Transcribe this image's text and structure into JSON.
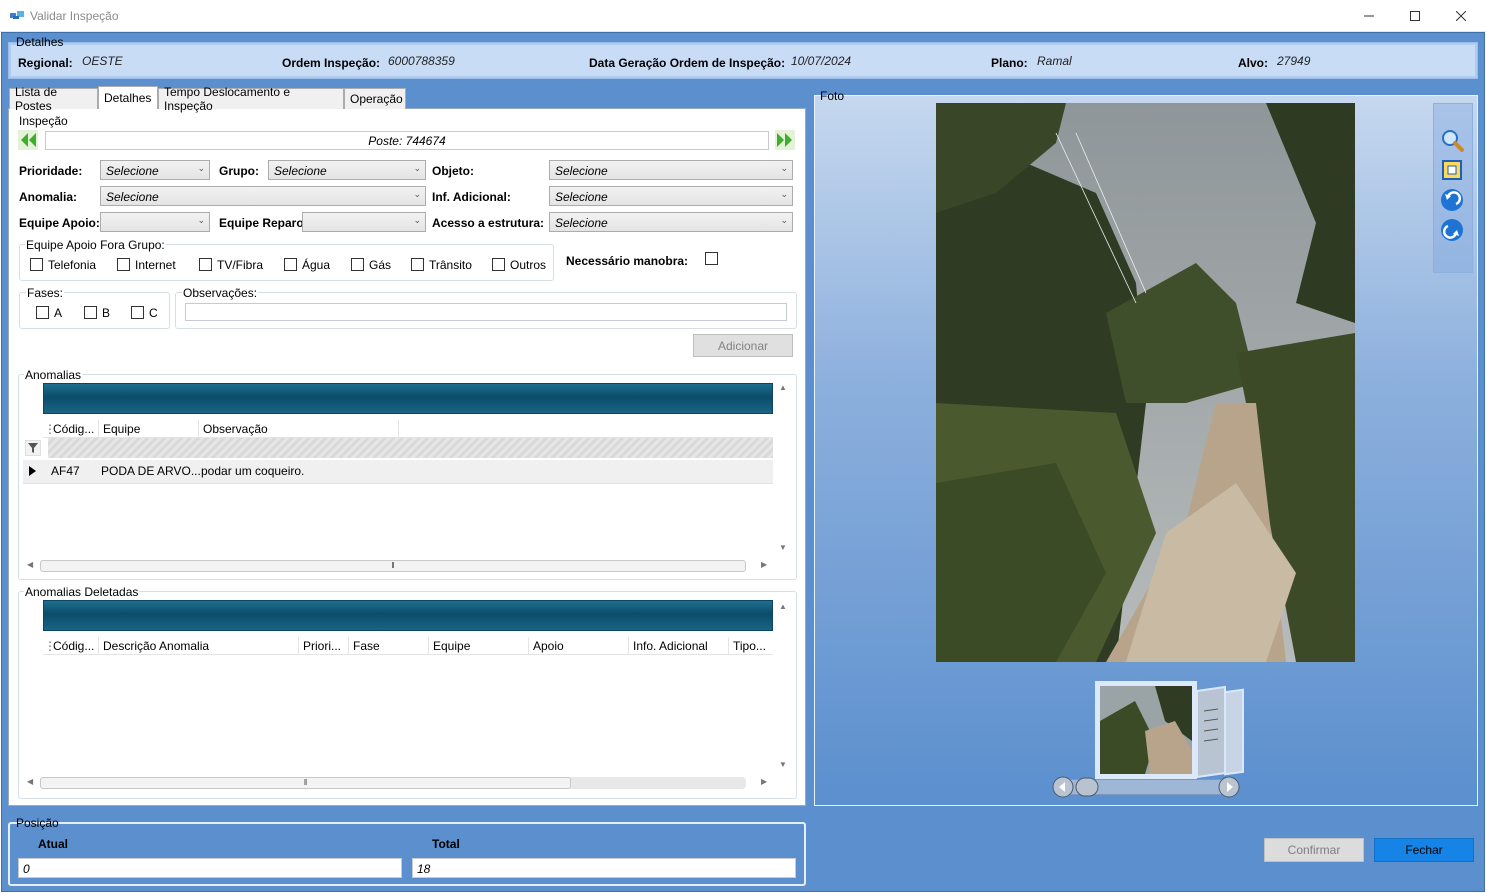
{
  "window": {
    "title": "Validar Inspeção"
  },
  "detalhes": {
    "legend": "Detalhes",
    "regional_label": "Regional:",
    "regional_value": "OESTE",
    "ordem_label": "Ordem Inspeção:",
    "ordem_value": "6000788359",
    "data_label": "Data Geração Ordem de Inspeção:",
    "data_value": "10/07/2024",
    "plano_label": "Plano:",
    "plano_value": "Ramal",
    "alvo_label": "Alvo:",
    "alvo_value": "27949"
  },
  "tabs": [
    {
      "label": "Lista de Postes"
    },
    {
      "label": "Detalhes"
    },
    {
      "label": "Tempo Deslocamento e Inspeção"
    },
    {
      "label": "Operação"
    }
  ],
  "inspecao": {
    "legend": "Inspeção",
    "poste": "Poste: 744674",
    "prioridade_label": "Prioridade:",
    "prioridade_value": "Selecione",
    "grupo_label": "Grupo:",
    "grupo_value": "Selecione",
    "objeto_label": "Objeto:",
    "objeto_value": "Selecione",
    "anomalia_label": "Anomalia:",
    "anomalia_value": "Selecione",
    "inf_label": "Inf. Adicional:",
    "inf_value": "Selecione",
    "equipe_apoio_label": "Equipe Apoio:",
    "equipe_apoio_value": "",
    "equipe_reparo_label": "Equipe Reparo:",
    "equipe_reparo_value": "",
    "acesso_label": "Acesso a estrutura:",
    "acesso_value": "Selecione",
    "fora_grupo_legend": "Equipe Apoio Fora Grupo:",
    "checks": [
      "Telefonia",
      "Internet",
      "TV/Fibra",
      "Água",
      "Gás",
      "Trânsito",
      "Outros"
    ],
    "manobra_label": "Necessário manobra:",
    "fases_legend": "Fases:",
    "fases": [
      "A",
      "B",
      "C"
    ],
    "obs_legend": "Observações:",
    "obs_value": "",
    "adicionar": "Adicionar"
  },
  "anomalias": {
    "legend": "Anomalias",
    "columns": [
      "Códig...",
      "Equipe",
      "Observação"
    ],
    "rows": [
      {
        "codigo": "AF47",
        "equipe": "PODA DE ARVO...",
        "observacao": "podar um coqueiro."
      }
    ]
  },
  "deletadas": {
    "legend": "Anomalias Deletadas",
    "columns": [
      "Códig...",
      "Descrição Anomalia",
      "Priori...",
      "Fase",
      "Equipe",
      "Apoio",
      "Info. Adicional",
      "Tipo..."
    ]
  },
  "foto": {
    "legend": "Foto"
  },
  "posicao": {
    "legend": "Posição",
    "atual_label": "Atual",
    "atual_value": "0",
    "total_label": "Total",
    "total_value": "18"
  },
  "buttons": {
    "confirmar": "Confirmar",
    "fechar": "Fechar"
  },
  "colors": {
    "accent": "#1684e7",
    "background": "#5b8fce",
    "banner": "#0a4c6a"
  }
}
